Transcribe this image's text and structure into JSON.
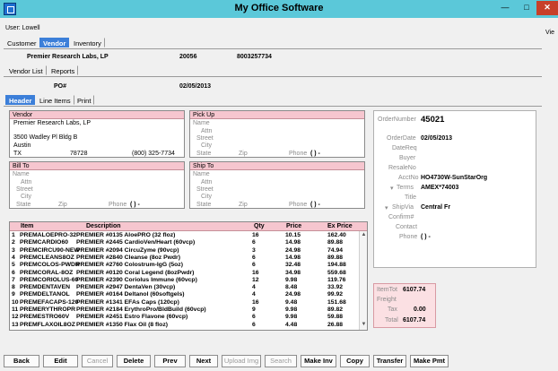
{
  "window": {
    "title": "My Office Software",
    "minimize": "—",
    "maximize": "□",
    "close": "✕"
  },
  "user_label": "User: Lowell",
  "view_label": "Vie",
  "main_tabs": [
    {
      "label": "Customer",
      "active": false
    },
    {
      "label": "Vendor",
      "active": true
    },
    {
      "label": "Inventory",
      "active": false
    }
  ],
  "vendor_header": {
    "name": "Premier Research Labs, LP",
    "code": "20056",
    "phone_id": "8003257734"
  },
  "sub_tabs": [
    {
      "label": "Vendor List"
    },
    {
      "label": "Reports"
    }
  ],
  "po": {
    "label": "PO#",
    "date": "02/05/2013"
  },
  "detail_tabs": [
    {
      "label": "Header",
      "active": true
    },
    {
      "label": "Line Items",
      "active": false
    },
    {
      "label": "Print",
      "active": false
    }
  ],
  "vendor_panel": {
    "title": "Vendor",
    "name": "Premier Research Labs, LP",
    "street": "3500 Wadley Pl Bldg B",
    "city": "Austin",
    "state": "TX",
    "zip": "78728",
    "phone": "(800) 325-7734"
  },
  "pickup_panel": {
    "title": "Pick Up",
    "labels": {
      "name": "Name",
      "attn": "Attn",
      "street": "Street",
      "city": "City",
      "state": "State",
      "zip": "Zip",
      "phone": "Phone"
    },
    "phone_value": "(  )   -"
  },
  "billto_panel": {
    "title": "Bill To",
    "labels": {
      "name": "Name",
      "attn": "Attn",
      "street": "Street",
      "city": "City",
      "state": "State",
      "zip": "Zip",
      "phone": "Phone"
    },
    "phone_value": "(  )   -"
  },
  "shipto_panel": {
    "title": "Ship To",
    "labels": {
      "name": "Name",
      "attn": "Attn",
      "street": "Street",
      "city": "City",
      "state": "State",
      "zip": "Zip",
      "phone": "Phone"
    },
    "phone_value": "(  )   -"
  },
  "items": {
    "columns": {
      "item": "Item",
      "description": "Description",
      "qty": "Qty",
      "price": "Price",
      "ex_price": "Ex Price"
    },
    "rows": [
      {
        "n": "1",
        "item": "PREMALOEPRO-32",
        "desc": "PREMIER #0135 AloePRO (32 floz)",
        "qty": "16",
        "price": "10.15",
        "ext": "162.40"
      },
      {
        "n": "2",
        "item": "PREMCARDIO60",
        "desc": "PREMIER #2445 CardioVen/Heart (60vcp)",
        "qty": "6",
        "price": "14.98",
        "ext": "89.88"
      },
      {
        "n": "3",
        "item": "PREMCIRCU90-NEW",
        "desc": "PREMIER #2094 CircuZyme (90vcp)",
        "qty": "3",
        "price": "24.98",
        "ext": "74.94"
      },
      {
        "n": "4",
        "item": "PREMCLEANS8OZ",
        "desc": "PREMIER #2840 Cleanse (8oz Pwdr)",
        "qty": "6",
        "price": "14.98",
        "ext": "89.88"
      },
      {
        "n": "5",
        "item": "PREMCOLOS-PWDR",
        "desc": "PREMIER #2760 Colostrum-IgG (5oz)",
        "qty": "6",
        "price": "32.48",
        "ext": "194.88"
      },
      {
        "n": "6",
        "item": "PREMCORAL-8OZ",
        "desc": "PREMIER #0120 Coral Legend (8ozPwdr)",
        "qty": "16",
        "price": "34.98",
        "ext": "559.68"
      },
      {
        "n": "7",
        "item": "PREMCORIOLUS-60",
        "desc": "PREMIER #2390 Coriolus Immune (60vcp)",
        "qty": "12",
        "price": "9.98",
        "ext": "119.76"
      },
      {
        "n": "8",
        "item": "PREMDENTAVEN",
        "desc": "PREMIER #2947 DentaVen (30vcp)",
        "qty": "4",
        "price": "8.48",
        "ext": "33.92"
      },
      {
        "n": "9",
        "item": "PREMDELTANOL",
        "desc": "PREMIER #0164 Deltanol (60softgels)",
        "qty": "4",
        "price": "24.98",
        "ext": "99.92"
      },
      {
        "n": "10",
        "item": "PREMEFACAPS-120",
        "desc": "PREMIER #1341 EFAs Caps (120cp)",
        "qty": "16",
        "price": "9.48",
        "ext": "151.68"
      },
      {
        "n": "11",
        "item": "PREMERYTHROPR",
        "desc": "PREMIER #2184 ErythroPro/BldBuild (60vcp)",
        "qty": "9",
        "price": "9.98",
        "ext": "89.82"
      },
      {
        "n": "12",
        "item": "PREMESTRO60V",
        "desc": "PREMIER #2451 Estro Flavone (60vcp)",
        "qty": "6",
        "price": "9.98",
        "ext": "59.88"
      },
      {
        "n": "13",
        "item": "PREMFLAXOIL8OZ",
        "desc": "PREMIER #1350 Flax Oil (8 floz)",
        "qty": "6",
        "price": "4.48",
        "ext": "26.88"
      }
    ]
  },
  "order_info": {
    "order_number_label": "OrderNumber",
    "order_number": "45021",
    "order_date_label": "OrderDate",
    "order_date": "02/05/2013",
    "date_req_label": "DateReq",
    "buyer_label": "Buyer",
    "resale_label": "ResaleNo",
    "acct_label": "AcctNo",
    "acct_value": "HO4730W-SunStarOrg",
    "terms_label": "Terms",
    "terms_value": "AMEX*74003",
    "title_label": "Title",
    "shipvia_label": "ShipVia",
    "shipvia_value": "Central Fr",
    "confirm_label": "Confirm#",
    "contact_label": "Contact",
    "phone_label": "Phone",
    "phone_value": "(  )   -"
  },
  "totals": {
    "item_tot_label": "ItemTot",
    "item_tot": "6107.74",
    "freight_label": "Freight",
    "tax_label": "Tax",
    "tax": "0.00",
    "total_label": "Total",
    "total": "6107.74"
  },
  "buttons": [
    {
      "label": "Back",
      "enabled": true
    },
    {
      "label": "Edit",
      "enabled": true
    },
    {
      "label": "Cancel",
      "enabled": false
    },
    {
      "label": "Delete",
      "enabled": true
    },
    {
      "label": "Prev",
      "enabled": true
    },
    {
      "label": "Next",
      "enabled": true
    },
    {
      "label": "Upload Img",
      "enabled": false
    },
    {
      "label": "Search",
      "enabled": false
    },
    {
      "label": "Make Inv",
      "enabled": true
    },
    {
      "label": "Copy",
      "enabled": true
    },
    {
      "label": "Transfer",
      "enabled": true
    },
    {
      "label": "Make Pmt",
      "enabled": true
    }
  ],
  "colors": {
    "title_bar": "#5bc8d9",
    "active_tab": "#3c7fd9",
    "panel_header": "#f6c6cf",
    "totals_bg": "#fbe0e3",
    "close_button": "#c7402a"
  }
}
